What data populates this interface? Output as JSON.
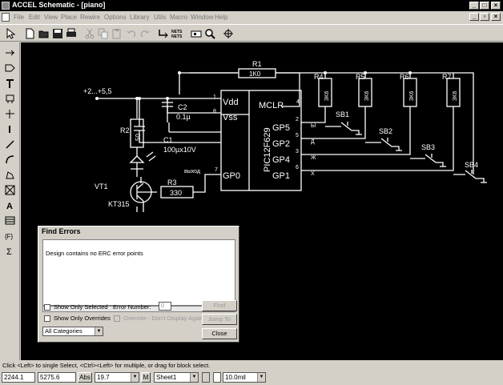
{
  "window": {
    "title": "ACCEL Schematic - [piano]"
  },
  "menu": [
    "File",
    "Edit",
    "View",
    "Place",
    "Rewire",
    "Options",
    "Library",
    "Utils",
    "Macro",
    "Window",
    "Help"
  ],
  "toolbar": {
    "netlist_label": "NETS",
    "nets_label": "NETS"
  },
  "schematic": {
    "supply_label": "+2...+5,5",
    "r1": "R1",
    "r1_val": "1K0",
    "r2": "R2",
    "r2_val": "50",
    "r3": "R3",
    "r3_val": "330",
    "r4": "R4",
    "r5": "R5",
    "r6": "R6",
    "r7": "R7",
    "r_pull_val": "3K6",
    "c1": "C1",
    "c1_val": "100µx10V",
    "c2": "C2",
    "c2_val": "0.1µ",
    "vt1": "VT1",
    "vt1_type": "KT315",
    "ic_name": "PIC12F629",
    "vdd": "Vdd",
    "vss": "Vss",
    "mclr": "MCLR",
    "gp5": "GP5",
    "gp2": "GP2",
    "gp4": "GP4",
    "gp1": "GP1",
    "gp0": "GP0",
    "pin1": "1",
    "pin8": "8",
    "pin4": "4",
    "pin2": "2",
    "pin5": "5",
    "pin3": "3",
    "pin6": "6",
    "pin7": "7",
    "out_label": "выход",
    "sb1": "SB1",
    "sb2": "SB2",
    "sb3": "SB3",
    "sb4": "SB4",
    "keys": [
      "Ы",
      "Д",
      "Ж",
      "Х"
    ]
  },
  "find_errors": {
    "title": "Find Errors",
    "message": "Design contains no ERC error points",
    "show_only_selected": "Show Only Selected",
    "show_only_overrides": "Show Only Overrides",
    "error_number_label": "Error Number:",
    "error_number_value": "0",
    "override_label": "Override - Don't Display Again",
    "category_value": "All Categories",
    "find_button": "Find",
    "jump_button": "Jump To",
    "close_button": "Close"
  },
  "status": {
    "hint": "Click <Left> to single Select, <Ctrl><Left> for multiple, or drag for block select."
  },
  "bottom": {
    "x": "2244.1",
    "y": "5275.6",
    "abs": "Abs",
    "grid": "19.7",
    "m": "M",
    "sheet": "Sheet1",
    "line": "10.0mil"
  }
}
